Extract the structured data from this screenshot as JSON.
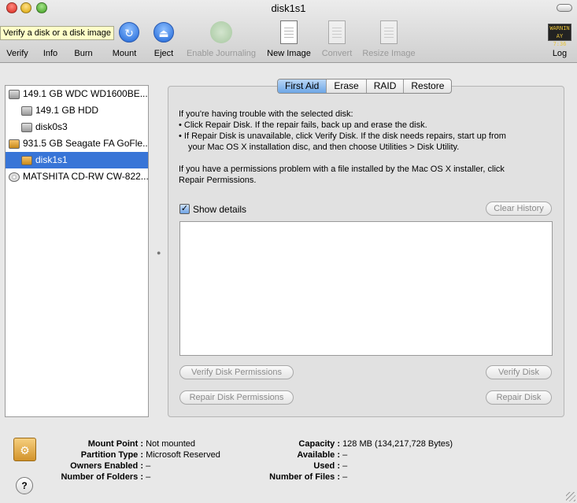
{
  "window": {
    "title": "disk1s1"
  },
  "toolbar": {
    "tooltip": "Verify a disk or a disk image",
    "items": [
      {
        "label": "Verify",
        "icon": "verify-icon"
      },
      {
        "label": "Info",
        "icon": "info-icon"
      },
      {
        "label": "Burn",
        "icon": "burn-icon"
      },
      {
        "label": "Mount",
        "icon": "mount-icon"
      },
      {
        "label": "Eject",
        "icon": "eject-icon"
      },
      {
        "label": "Enable Journaling",
        "icon": "journaling-icon"
      },
      {
        "label": "New Image",
        "icon": "new-image-icon"
      },
      {
        "label": "Convert",
        "icon": "convert-icon"
      },
      {
        "label": "Resize Image",
        "icon": "resize-image-icon"
      },
      {
        "label": "Log",
        "icon": "log-icon"
      }
    ],
    "log_icon_text": [
      "WARNIN",
      "AY 7:36"
    ]
  },
  "sidebar": {
    "items": [
      {
        "label": "149.1 GB WDC WD1600BE...",
        "icon": "internal-disk-icon"
      },
      {
        "label": "149.1 GB HDD",
        "icon": "volume-icon"
      },
      {
        "label": "disk0s3",
        "icon": "volume-icon"
      },
      {
        "label": "931.5 GB Seagate FA GoFle...",
        "icon": "external-disk-icon"
      },
      {
        "label": "disk1s1",
        "icon": "external-volume-icon"
      },
      {
        "label": "MATSHITA CD-RW CW-822...",
        "icon": "optical-drive-icon"
      }
    ]
  },
  "tabs": [
    "First Aid",
    "Erase",
    "RAID",
    "Restore"
  ],
  "first_aid": {
    "intro": "If you're having trouble with the selected disk:",
    "bullet1": "Click Repair Disk. If the repair fails, back up and erase the disk.",
    "bullet2a": "If Repair Disk is unavailable, click Verify Disk. If the disk needs repairs, start up from",
    "bullet2b": "your Mac OS X installation disc, and then choose Utilities > Disk Utility.",
    "perm1": "If you have a permissions problem with a file installed by the Mac OS X installer, click",
    "perm2": "Repair Permissions.",
    "show_details": "Show details",
    "clear_history": "Clear History",
    "verify_permissions": "Verify Disk Permissions",
    "repair_permissions": "Repair Disk Permissions",
    "verify_disk": "Verify Disk",
    "repair_disk": "Repair Disk"
  },
  "info": {
    "mount_point_label": "Mount Point :",
    "mount_point": "Not mounted",
    "partition_type_label": "Partition Type :",
    "partition_type": "Microsoft Reserved",
    "owners_enabled_label": "Owners Enabled :",
    "owners_enabled": "–",
    "folders_label": "Number of Folders :",
    "folders": "–",
    "capacity_label": "Capacity :",
    "capacity": "128 MB (134,217,728 Bytes)",
    "available_label": "Available :",
    "available": "–",
    "used_label": "Used :",
    "used": "–",
    "files_label": "Number of Files :",
    "files": "–"
  }
}
